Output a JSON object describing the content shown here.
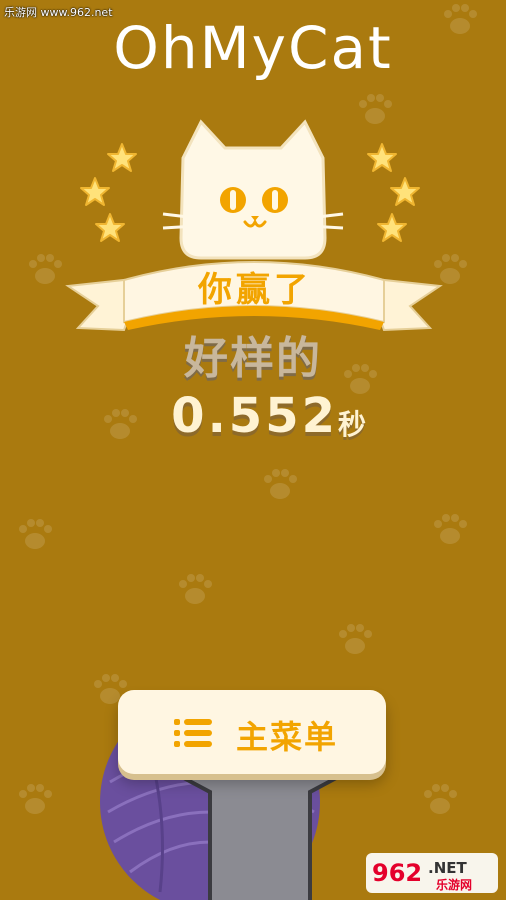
{
  "watermark": "乐游网 www.962.net",
  "title": "OhMyCat",
  "banner_text": "你赢了",
  "praise_text": "好样的",
  "time_value": "0.552",
  "time_unit": "秒",
  "main_menu_label": "主菜单",
  "colors": {
    "background": "#aa7a0f",
    "accent": "#f2a400",
    "cream": "#fff6e2",
    "yarn": "#6a4f9e"
  },
  "icons": {
    "menu": "list-icon",
    "cat": "cat-face-icon",
    "star": "star-icon",
    "paw": "paw-print-icon"
  },
  "logo": {
    "mark": "962",
    "net": ".NET",
    "cn": "乐游网"
  }
}
